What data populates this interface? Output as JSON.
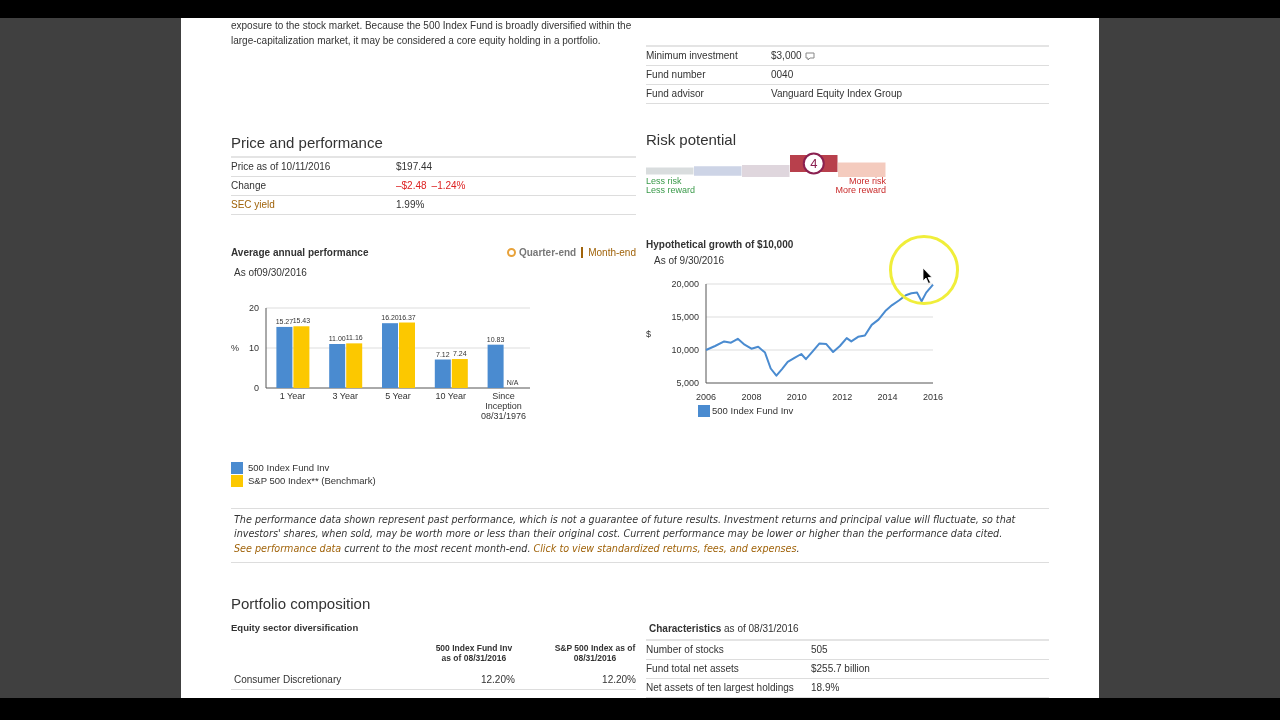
{
  "intro": "exposure to the stock market. Because the 500 Index Fund is broadly diversified within the large-capitalization market, it may be considered a core equity holding in a portfolio.",
  "fund_facts": [
    {
      "label": "Minimum investment",
      "value": "$3,000",
      "note_icon": true
    },
    {
      "label": "Fund number",
      "value": "0040",
      "note_icon": false
    },
    {
      "label": "Fund advisor",
      "value": "Vanguard Equity Index Group",
      "note_icon": false
    }
  ],
  "price_performance": {
    "title": "Price and performance",
    "rows": [
      {
        "label": "Price as of 10/11/2016",
        "values": [
          "$197.44"
        ],
        "kind": "plain"
      },
      {
        "label": "Change",
        "values": [
          "–$2.48",
          "–1.24%"
        ],
        "kind": "negative"
      },
      {
        "label": "SEC yield",
        "values": [
          "1.99%"
        ],
        "kind": "link"
      }
    ]
  },
  "risk": {
    "title": "Risk potential",
    "value": "4",
    "segments": [
      {
        "selected": false
      },
      {
        "selected": false
      },
      {
        "selected": false
      },
      {
        "selected": true
      },
      {
        "selected": false
      }
    ],
    "low_labels": [
      "Less risk",
      "Less reward"
    ],
    "high_labels": [
      "More risk",
      "More reward"
    ]
  },
  "average_performance": {
    "title": "Average annual performance",
    "subtitle": "As of09/30/2016",
    "options": [
      {
        "label": "Quarter-end",
        "selected": true
      },
      {
        "label": "Month-end",
        "selected": false
      }
    ],
    "na_label": "N/A",
    "chart_data": {
      "type": "bar",
      "ylabel": "%",
      "categories": [
        "1 Year",
        "3 Year",
        "5 Year",
        "10 Year",
        "Since Inception 08/31/1976"
      ],
      "ylim": [
        0,
        20
      ],
      "yticks": [
        0,
        10,
        20
      ],
      "data_labels": true,
      "series": [
        {
          "name": "500 Index Fund Inv",
          "color": "#4a8bd0",
          "values": [
            15.27,
            11.0,
            16.2,
            7.12,
            10.83
          ],
          "value_labels": [
            "15.27",
            "11.00",
            "16.20",
            "7.12",
            "10.83"
          ]
        },
        {
          "name": "S&P 500 Index** (Benchmark)",
          "color": "#fcc800",
          "values": [
            15.43,
            11.16,
            16.37,
            7.24,
            null
          ],
          "value_labels": [
            "15.43",
            "11.16",
            "16.37",
            "7.24",
            null
          ]
        }
      ]
    }
  },
  "growth": {
    "title": "Hypothetical growth of $10,000",
    "subtitle": "As of 9/30/2016",
    "chart_data": {
      "type": "line",
      "ylabel": "$",
      "xlim": [
        2006,
        2016
      ],
      "ylim": [
        5000,
        20000
      ],
      "xticks": [
        2006,
        2008,
        2010,
        2012,
        2014,
        2016
      ],
      "yticks": [
        {
          "value": 5000,
          "label": "5,000"
        },
        {
          "value": 10000,
          "label": "10,000"
        },
        {
          "value": 15000,
          "label": "15,000"
        },
        {
          "value": 20000,
          "label": "20,000"
        }
      ],
      "x": [
        2006,
        2006.4,
        2006.8,
        2007.1,
        2007.4,
        2007.7,
        2008,
        2008.3,
        2008.6,
        2008.85,
        2009.1,
        2009.35,
        2009.6,
        2009.9,
        2010.2,
        2010.4,
        2010.7,
        2011,
        2011.3,
        2011.6,
        2011.9,
        2012.2,
        2012.4,
        2012.7,
        2013,
        2013.3,
        2013.6,
        2013.9,
        2014.2,
        2014.5,
        2014.8,
        2015.05,
        2015.3,
        2015.5,
        2015.7,
        2016
      ],
      "series": [
        {
          "name": "500 Index Fund Inv",
          "color": "#4a8bd0",
          "values": [
            10000,
            10600,
            11300,
            11100,
            11700,
            10800,
            10200,
            10500,
            9600,
            7200,
            6100,
            7100,
            8200,
            8800,
            9400,
            8600,
            9800,
            11000,
            10900,
            9700,
            10600,
            11800,
            11300,
            12000,
            12200,
            13800,
            14600,
            15900,
            16800,
            17500,
            18300,
            18600,
            18700,
            17400,
            18700,
            19900
          ]
        }
      ]
    }
  },
  "disclaimer": [
    {
      "kind": "text",
      "text": "The performance data shown represent past performance, which is not a guarantee of future results. Investment returns and principal value will fluctuate, so that investors' shares, when sold, may be worth more or less than their original cost. Current performance may be lower or higher than the performance data cited. "
    },
    {
      "kind": "link",
      "text": "See performance data"
    },
    {
      "kind": "text",
      "text": " current to the most recent month-end. "
    },
    {
      "kind": "link",
      "text": "Click to view standardized returns, fees, and expenses"
    },
    {
      "kind": "text",
      "text": "."
    }
  ],
  "portfolio": {
    "title": "Portfolio composition",
    "sector": {
      "title": "Equity sector diversification",
      "columns": [
        "500 Index Fund Inv as of 08/31/2016",
        "S&P 500 Index as of 08/31/2016"
      ],
      "rows": [
        {
          "label": "Consumer Discretionary",
          "values": [
            "12.20%",
            "12.20%"
          ]
        }
      ]
    },
    "characteristics": {
      "title": "**Characteristics** as of 08/31/2016",
      "rows": [
        {
          "label": "Number of stocks",
          "value": "505"
        },
        {
          "label": "Fund total net assets",
          "value": "$255.7 billion"
        },
        {
          "label": "Net assets of ten largest holdings",
          "value": "18.9%"
        }
      ]
    }
  }
}
